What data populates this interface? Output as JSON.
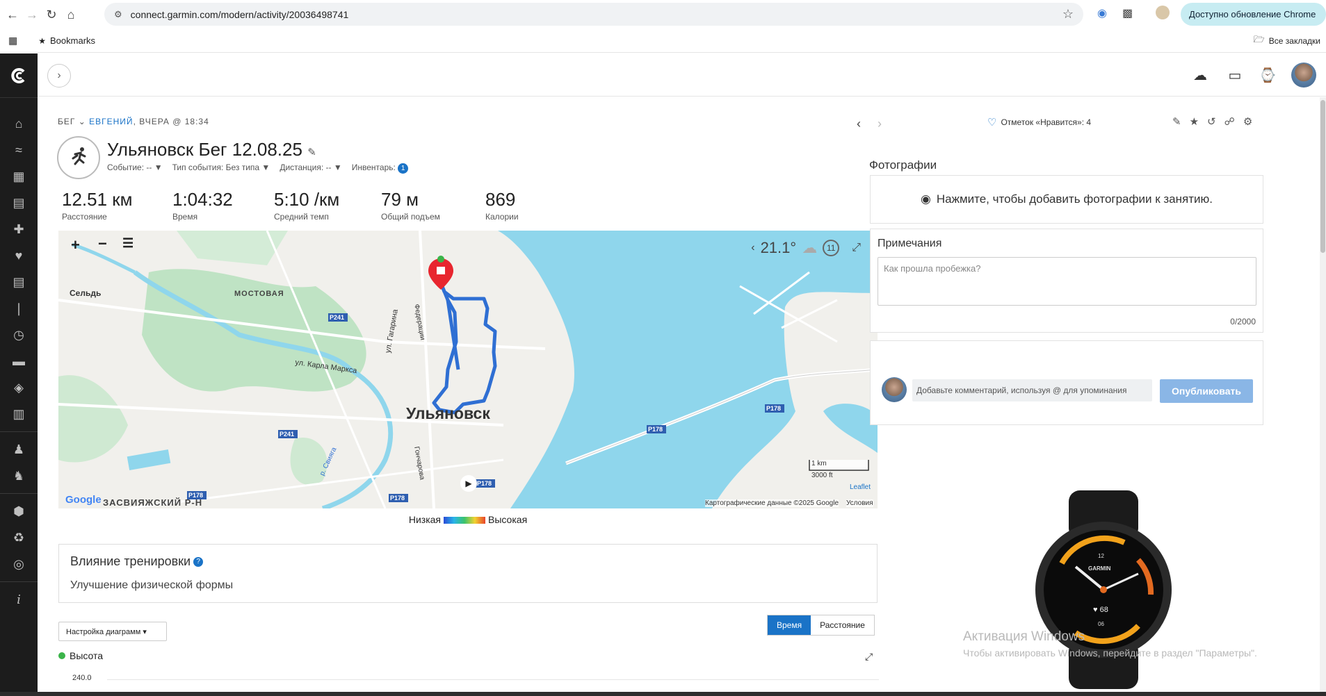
{
  "browser": {
    "url": "connect.garmin.com/modern/activity/20036498741",
    "update_label": "Доступно обновление Chrome",
    "bookmarks_label": "Bookmarks",
    "all_bookmarks_label": "Все закладки"
  },
  "activity": {
    "breadcrumb_type": "БЕГ",
    "breadcrumb_user": "ЕВГЕНИЙ",
    "breadcrumb_time": ", ВЧЕРА @ 18:34",
    "title": "Ульяновск Бег 12.08.25",
    "meta_event": "Событие: -- ▼",
    "meta_type": "Тип события: Без типа ▼",
    "meta_distance": "Дистанция: -- ▼",
    "meta_gear": "Инвентарь:",
    "gear_count": "1"
  },
  "stats": [
    {
      "value": "12.51 км",
      "label": "Расстояние"
    },
    {
      "value": "1:04:32",
      "label": "Время"
    },
    {
      "value": "5:10 /км",
      "label": "Средний темп"
    },
    {
      "value": "79 м",
      "label": "Общий подъем"
    },
    {
      "value": "869",
      "label": "Калории"
    }
  ],
  "map": {
    "weather_temp": "21.1°",
    "weather_wind": "11",
    "city_label": "Ульяновск",
    "labels": {
      "selde": "Сельдь",
      "mostovaya": "МОСТОВАЯ",
      "karla_marksa": "ул. Карла Маркса",
      "gagarina": "ул. Гагарина",
      "zasviyazh": "ЗАСВИЯЖСКИЙ Р-Н",
      "p241a": "P241",
      "p241b": "P241",
      "p178a": "P178",
      "p178b": "P178",
      "p178c": "P178",
      "p178d": "P178",
      "p178e": "P178",
      "sviyaga": "р. Свияга",
      "goncharova": "Гончарова",
      "federatsii": "Федерации"
    },
    "scale_km": "1 km",
    "scale_ft": "3000 ft",
    "attribution": "Картографические данные ©2025 Google",
    "terms": "Условия",
    "leaflet": "Leaflet",
    "google": "Google"
  },
  "legend": {
    "low": "Низкая",
    "high": "Высокая"
  },
  "training_effect": {
    "title": "Влияние тренировки",
    "value": "Улучшение физической формы"
  },
  "chart_controls": {
    "settings_label": "Настройка диаграмм ▾",
    "tab_time": "Время",
    "tab_distance": "Расстояние",
    "series_label": "Высота",
    "y_tick_top": "240.0"
  },
  "right": {
    "likes": "Отметок «Нравится»: 4",
    "photos_title": "Фотографии",
    "photos_cta": "Нажмите, чтобы добавить фотографии к занятию.",
    "notes_title": "Примечания",
    "notes_placeholder": "Как прошла пробежка?",
    "notes_counter": "0/2000",
    "comment_placeholder": "Добавьте комментарий, используя @ для упоминания",
    "publish_label": "Опубликовать"
  },
  "watch": {
    "brand": "GARMIN",
    "hr": "68",
    "n12": "12",
    "n06": "06"
  },
  "os_watermark": {
    "line1": "Активация Windows",
    "line2": "Чтобы активировать Windows, перейдите в раздел \"Параметры\"."
  },
  "colors": {
    "accent": "#1a73c7",
    "route": "#2f6fd3",
    "water": "#8fd6ec",
    "sidebar": "#1c1c1c"
  }
}
